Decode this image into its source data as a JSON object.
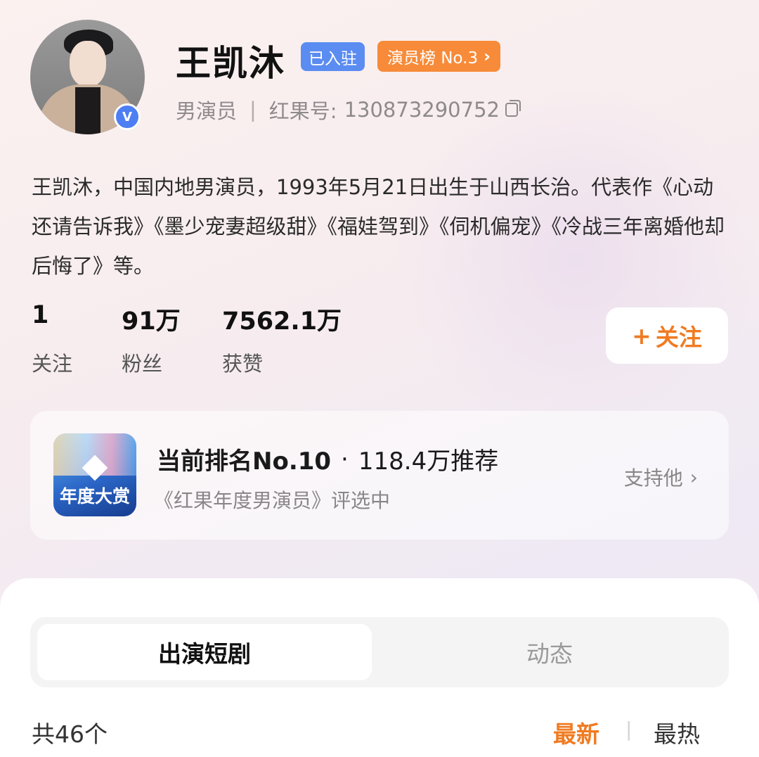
{
  "profile": {
    "name": "王凯沐",
    "settled_badge": "已入驻",
    "rank_badge": "演员榜 No.3",
    "role": "男演员",
    "separator": "|",
    "id_label": "红果号:",
    "id_value": "130873290752",
    "verified_mark": "V",
    "bio": "王凯沐，中国内地男演员，1993年5月21日出生于山西长治。代表作《心动还请告诉我》《墨少宠妻超级甜》《福娃驾到》《伺机偏宠》《冷战三年离婚他却后悔了》等。"
  },
  "stats": [
    {
      "value": "1",
      "label": "关注"
    },
    {
      "value": "91万",
      "label": "粉丝"
    },
    {
      "value": "7562.1万",
      "label": "获赞"
    }
  ],
  "follow_button": {
    "plus": "+",
    "label": "关注"
  },
  "award": {
    "icon_text": "年度大赏",
    "rank_text": "当前排名No.10",
    "dot": "·",
    "recommend_text": "118.4万推荐",
    "subtitle": "《红果年度男演员》评选中",
    "action": "支持他"
  },
  "tabs": [
    {
      "label": "出演短剧",
      "active": true
    },
    {
      "label": "动态",
      "active": false
    }
  ],
  "list": {
    "count": "共46个",
    "sort_new": "最新",
    "sort_sep": "|",
    "sort_hot": "最热"
  },
  "colors": {
    "accent_orange": "#f07b22",
    "badge_blue": "#5b8cf1",
    "badge_orange": "#f78b39"
  }
}
